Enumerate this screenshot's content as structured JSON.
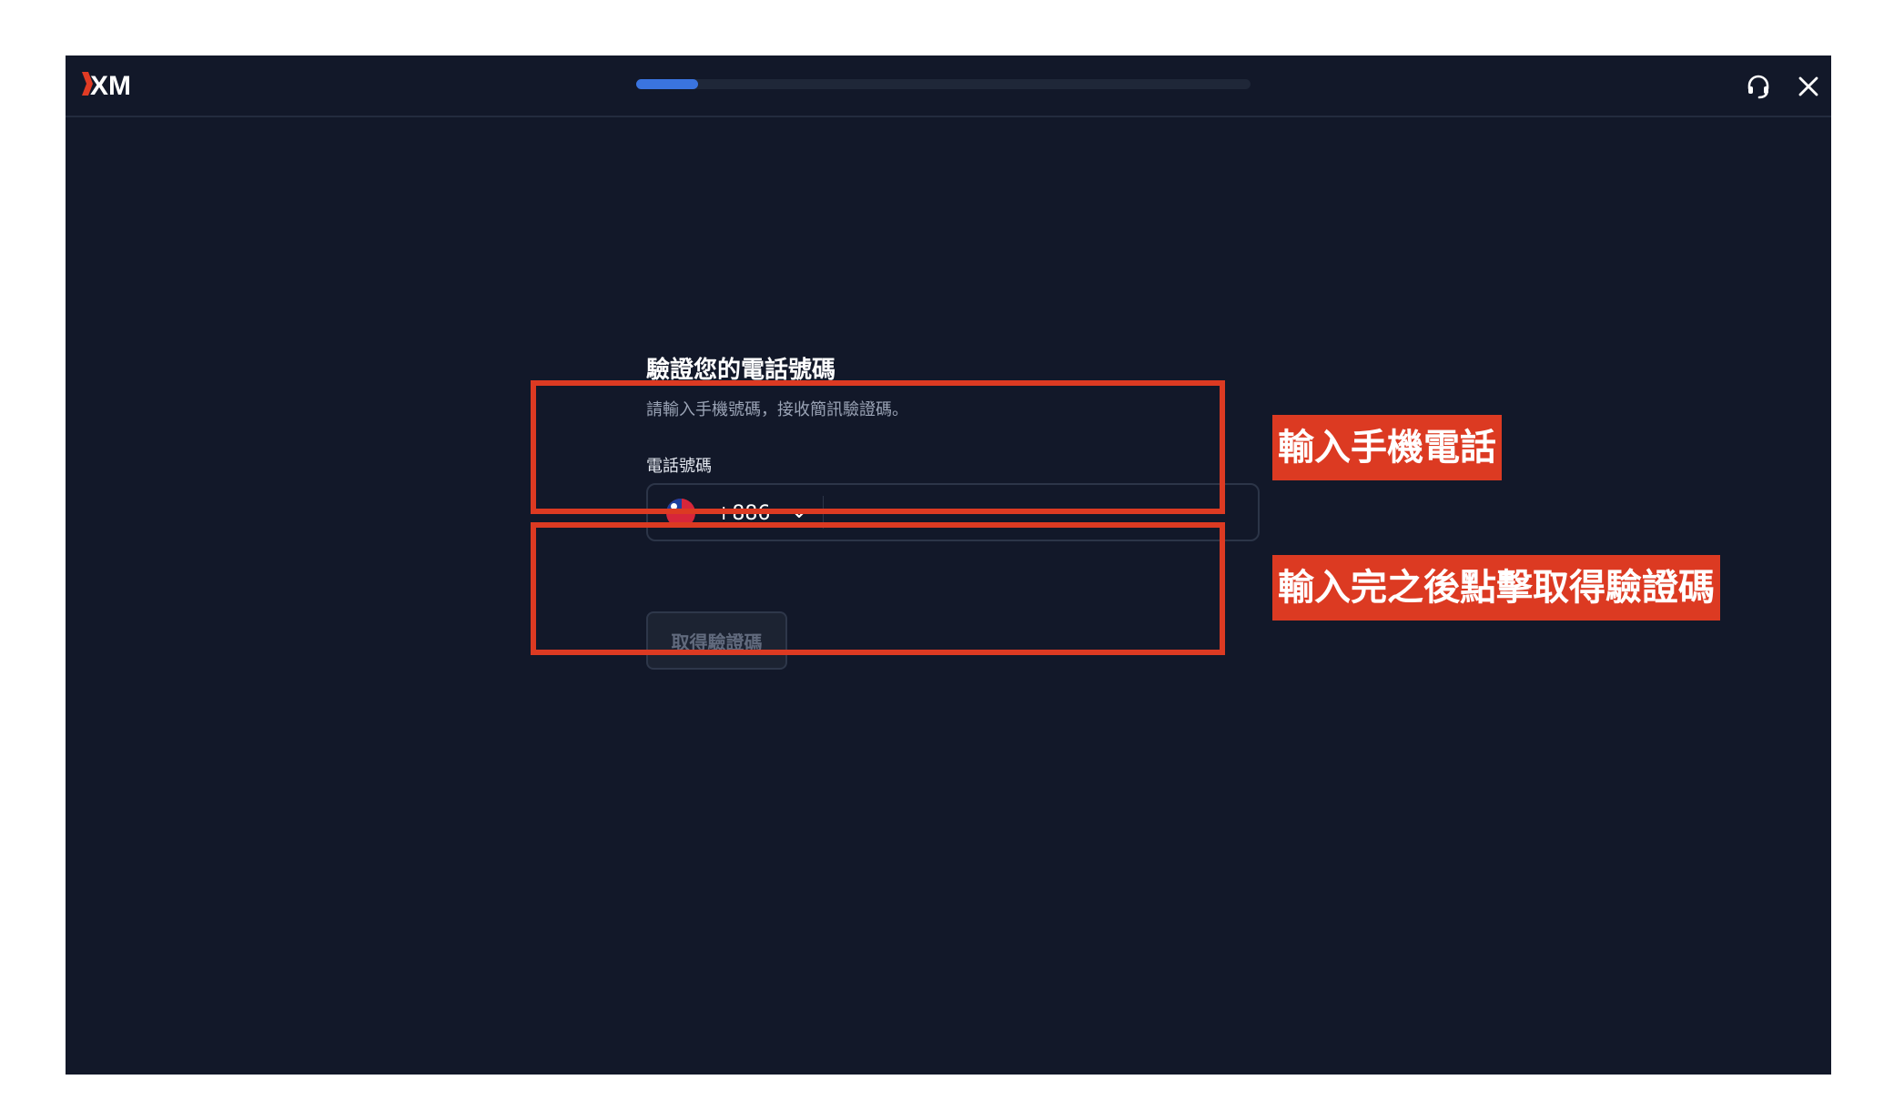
{
  "header": {
    "logo_text": "XM",
    "progress_percent": 10,
    "support_icon": "headset-icon",
    "close_icon": "close-icon"
  },
  "form": {
    "title": "驗證您的電話號碼",
    "subtitle": "請輸入手機號碼，接收簡訊驗證碼。",
    "phone_label": "電話號碼",
    "country_flag": "taiwan-flag-icon",
    "dial_code": "+886",
    "phone_value": "",
    "phone_placeholder": "",
    "get_code_label": "取得驗證碼"
  },
  "annotations": {
    "callout_1": "輸入手機電話",
    "callout_2": "輸入完之後點擊取得驗證碼",
    "color": "#dc3a22"
  },
  "colors": {
    "background": "#121829",
    "accent": "#3a74df"
  }
}
